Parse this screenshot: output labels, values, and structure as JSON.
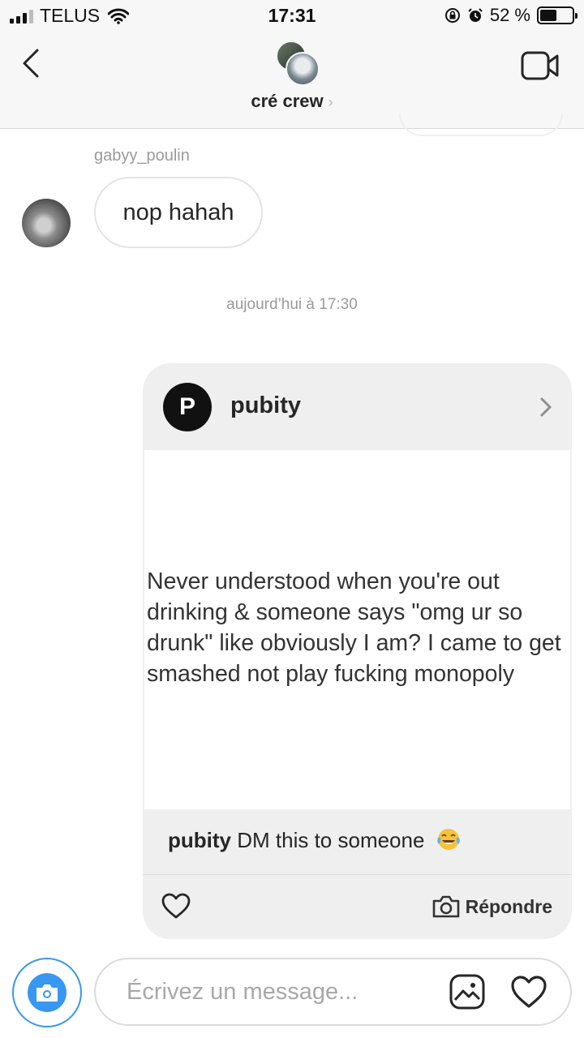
{
  "status_bar": {
    "carrier": "TELUS",
    "time": "17:31",
    "battery_percent": "52 %",
    "battery_level": 0.52,
    "icons": [
      "signal-icon",
      "wifi-icon",
      "rotation-lock-icon",
      "alarm-icon",
      "battery-icon"
    ]
  },
  "header": {
    "title": "cré crew",
    "chevron": "›",
    "icons": [
      "back-chevron-icon",
      "group-avatar",
      "video-call-icon"
    ]
  },
  "conversation": {
    "sender_name": "gabyy_poulin",
    "message_text": "nop hahah",
    "timestamp": "aujourd’hui à 17:30"
  },
  "shared_post": {
    "account": "pubity",
    "logo_letter": "P",
    "quote": "Never understood when you're out drinking & someone says \"omg ur so drunk\" like obviously I am? I came to get smashed not play fucking monopoly",
    "caption_user": "pubity",
    "caption_text": "DM this to someone",
    "caption_emoji": "tears-of-joy-emoji",
    "reply_label": "Répondre",
    "icons": [
      "heart-icon",
      "camera-icon",
      "chevron-right-icon"
    ]
  },
  "composer": {
    "placeholder": "Écrivez un message...",
    "icons": [
      "camera-icon",
      "gallery-icon",
      "heart-icon"
    ]
  },
  "colors": {
    "accent": "#3897f0",
    "header_bg": "#f7f7f7",
    "card_bg": "#efefef",
    "text": "#262626",
    "muted": "#9a9a9a"
  }
}
